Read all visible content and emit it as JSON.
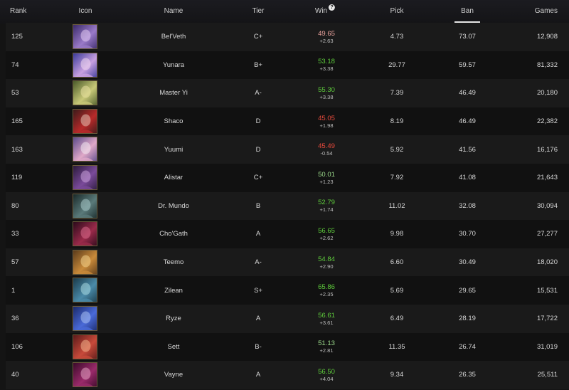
{
  "columns": {
    "rank": "Rank",
    "icon": "Icon",
    "name": "Name",
    "tier": "Tier",
    "win": "Win",
    "pick": "Pick",
    "ban": "Ban",
    "games": "Games"
  },
  "colors": {
    "green": "#5ecb3c",
    "red": "#e84a3c",
    "muted": "#dadada"
  },
  "rows": [
    {
      "rank": "125",
      "name": "Bel'Veth",
      "tier": "C+",
      "win": "49.65",
      "delta": "+2.63",
      "win_color": "#e8a29c",
      "pick": "4.73",
      "ban": "73.07",
      "games": "12,908",
      "portrait": [
        "#3a2a6a",
        "#9a7ac8",
        "#e0c8f0"
      ]
    },
    {
      "rank": "74",
      "name": "Yunara",
      "tier": "B+",
      "win": "53.18",
      "delta": "+3.38",
      "win_color": "#5ecb3c",
      "pick": "29.77",
      "ban": "59.57",
      "games": "81,332",
      "portrait": [
        "#3a3a9a",
        "#c8a0e0",
        "#f0d8f0"
      ]
    },
    {
      "rank": "53",
      "name": "Master Yi",
      "tier": "A-",
      "win": "55.30",
      "delta": "+3.38",
      "win_color": "#5ecb3c",
      "pick": "7.39",
      "ban": "46.49",
      "games": "20,180",
      "portrait": [
        "#4a5a2a",
        "#c8c878",
        "#e8e0a0"
      ]
    },
    {
      "rank": "165",
      "name": "Shaco",
      "tier": "D",
      "win": "45.05",
      "delta": "+1.98",
      "win_color": "#e84a3c",
      "pick": "8.19",
      "ban": "46.49",
      "games": "22,382",
      "portrait": [
        "#3a1a1a",
        "#b82a2a",
        "#e0c0b0"
      ]
    },
    {
      "rank": "163",
      "name": "Yuumi",
      "tier": "D",
      "win": "45.49",
      "delta": "-0.54",
      "win_color": "#e84a3c",
      "pick": "5.92",
      "ban": "41.56",
      "games": "16,176",
      "portrait": [
        "#5a4a8a",
        "#e0a8c8",
        "#f0e8f0"
      ]
    },
    {
      "rank": "119",
      "name": "Alistar",
      "tier": "C+",
      "win": "50.01",
      "delta": "+1.23",
      "win_color": "#9ad88a",
      "pick": "7.92",
      "ban": "41.08",
      "games": "21,643",
      "portrait": [
        "#2a1a3a",
        "#7a4a9a",
        "#c8a0d8"
      ]
    },
    {
      "rank": "80",
      "name": "Dr. Mundo",
      "tier": "B",
      "win": "52.79",
      "delta": "+1.74",
      "win_color": "#5ecb3c",
      "pick": "11.02",
      "ban": "32.08",
      "games": "30,094",
      "portrait": [
        "#1a2a2a",
        "#5a7a7a",
        "#a8c8c8"
      ]
    },
    {
      "rank": "33",
      "name": "Cho'Gath",
      "tier": "A",
      "win": "56.65",
      "delta": "+2.62",
      "win_color": "#5ecb3c",
      "pick": "9.98",
      "ban": "30.70",
      "games": "27,277",
      "portrait": [
        "#2a0a1a",
        "#9a2a4a",
        "#d86a8a"
      ]
    },
    {
      "rank": "57",
      "name": "Teemo",
      "tier": "A-",
      "win": "54.84",
      "delta": "+2.90",
      "win_color": "#5ecb3c",
      "pick": "6.60",
      "ban": "30.49",
      "games": "18,020",
      "portrait": [
        "#5a3a1a",
        "#c88a3a",
        "#f0d08a"
      ]
    },
    {
      "rank": "1",
      "name": "Zilean",
      "tier": "S+",
      "win": "65.86",
      "delta": "+2.35",
      "win_color": "#5ecb3c",
      "pick": "5.69",
      "ban": "29.65",
      "games": "15,531",
      "portrait": [
        "#1a3a4a",
        "#4a8aa8",
        "#a8d8e0"
      ]
    },
    {
      "rank": "36",
      "name": "Ryze",
      "tier": "A",
      "win": "56.61",
      "delta": "+3.61",
      "win_color": "#5ecb3c",
      "pick": "6.49",
      "ban": "28.19",
      "games": "17,722",
      "portrait": [
        "#1a2a6a",
        "#4a6ad8",
        "#a8c0f0"
      ]
    },
    {
      "rank": "106",
      "name": "Sett",
      "tier": "B-",
      "win": "51.13",
      "delta": "+2.81",
      "win_color": "#9ad88a",
      "pick": "11.35",
      "ban": "26.74",
      "games": "31,019",
      "portrait": [
        "#5a1a1a",
        "#c84a3a",
        "#f0b08a"
      ]
    },
    {
      "rank": "40",
      "name": "Vayne",
      "tier": "A",
      "win": "56.50",
      "delta": "+4.04",
      "win_color": "#5ecb3c",
      "pick": "9.34",
      "ban": "26.35",
      "games": "25,511",
      "portrait": [
        "#3a0a2a",
        "#9a2a6a",
        "#e0a0c0"
      ]
    }
  ]
}
